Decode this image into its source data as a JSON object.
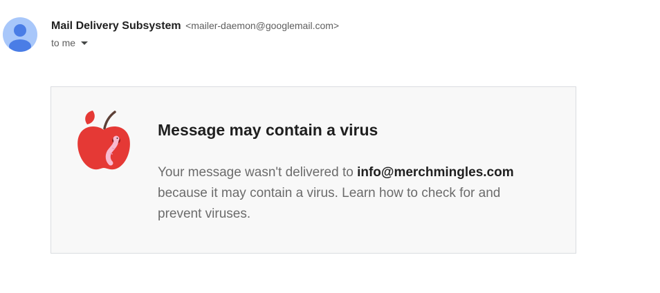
{
  "sender": {
    "name": "Mail Delivery Subsystem",
    "email": "<mailer-daemon@googlemail.com>",
    "avatar_icon": "person-icon"
  },
  "recipient": {
    "label": "to me",
    "caret_icon": "caret-down-icon"
  },
  "notice": {
    "icon": "apple-with-worm-icon",
    "title": "Message may contain a virus",
    "body_prefix": "Your message wasn't delivered to ",
    "recipient_email": "info@merchmingles.com",
    "body_middle": " because it may contain a virus. ",
    "learn_link": "Learn how to check for and prevent viruses",
    "body_suffix": "."
  },
  "colors": {
    "avatar_bg": "#a8c7fa",
    "avatar_fg": "#4a7de6",
    "card_bg": "#f8f8f8",
    "apple_red": "#e53935",
    "stem_brown": "#5d4037",
    "worm_pink": "#f8bbd0"
  }
}
